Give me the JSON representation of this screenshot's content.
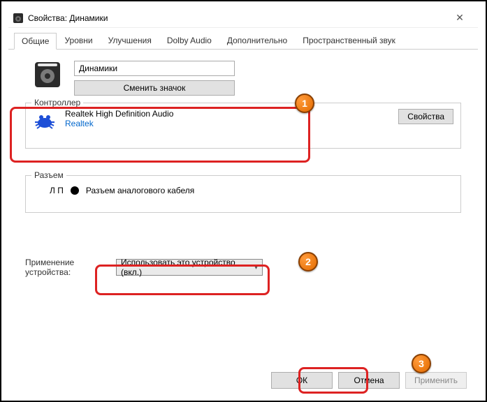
{
  "window": {
    "title": "Свойства: Динамики"
  },
  "tabs": {
    "t0": "Общие",
    "t1": "Уровни",
    "t2": "Улучшения",
    "t3": "Dolby Audio",
    "t4": "Дополнительно",
    "t5": "Пространственный звук"
  },
  "general": {
    "device_name": "Динамики",
    "change_icon_btn": "Сменить значок"
  },
  "controller": {
    "legend": "Контроллер",
    "name": "Realtek High Definition Audio",
    "vendor": "Realtek",
    "properties_btn": "Свойства"
  },
  "jacks": {
    "legend": "Разъем",
    "lr": "Л П",
    "desc": "Разъем аналогового кабеля"
  },
  "usage": {
    "label": "Применение устройства:",
    "selected": "Использовать это устройство (вкл.)"
  },
  "footer": {
    "ok": "ОК",
    "cancel": "Отмена",
    "apply": "Применить"
  },
  "markers": {
    "m1": "1",
    "m2": "2",
    "m3": "3"
  }
}
